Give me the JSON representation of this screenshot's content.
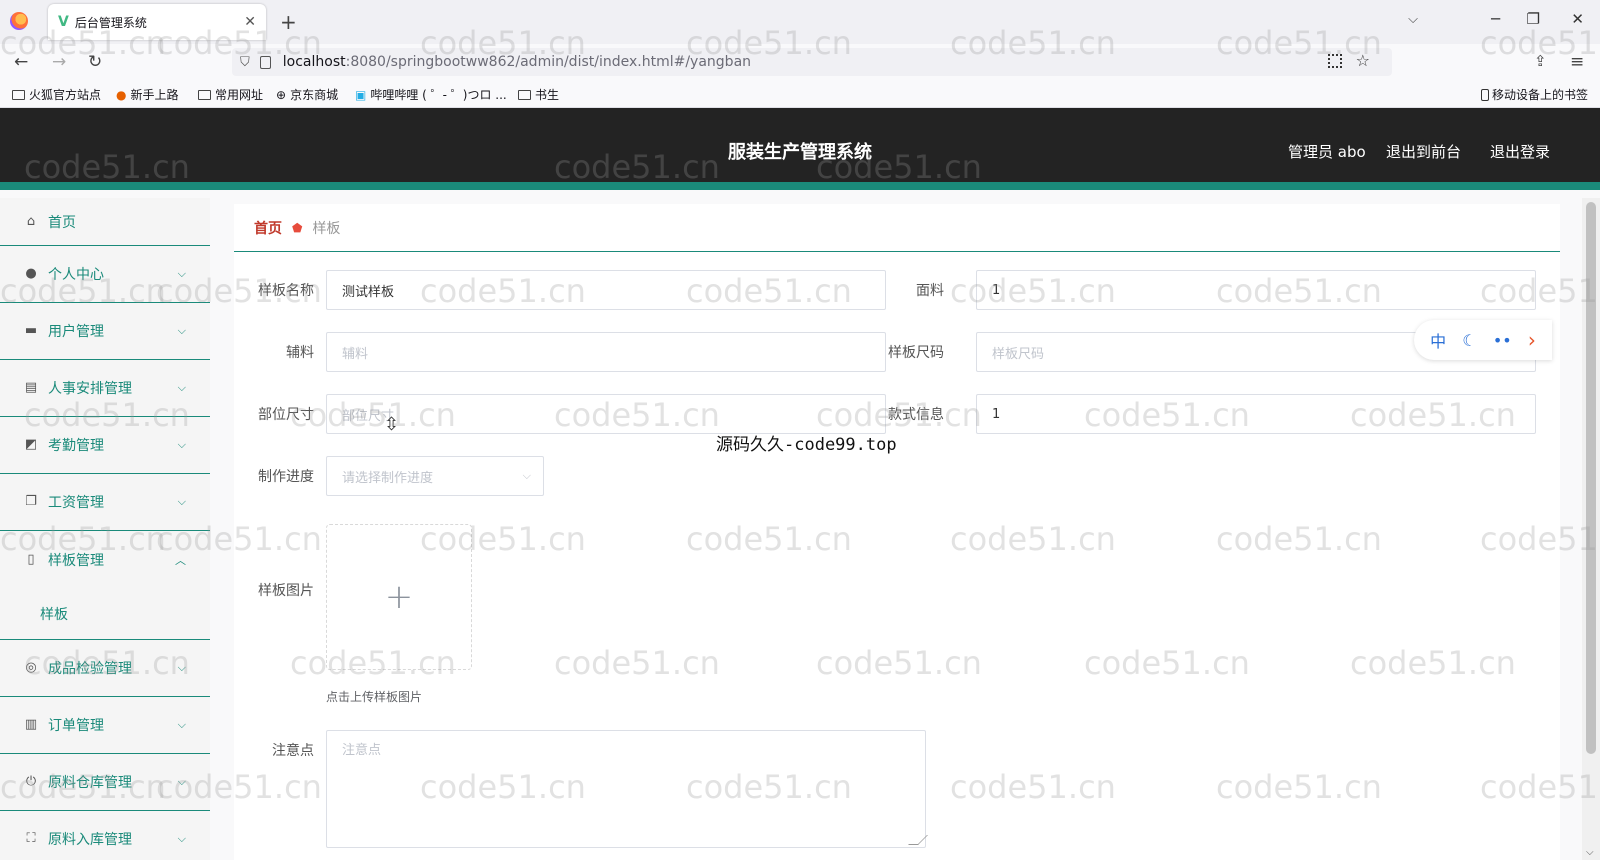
{
  "browser": {
    "tab_title": "后台管理系统",
    "url_host": "localhost",
    "url_path": ":8080/springbootww862/admin/dist/index.html#/yangban",
    "bookmarks": [
      "火狐官方站点",
      "新手上路",
      "常用网址",
      "京东商城",
      "哔哩哔哩 ( ゜- ゜)つロ ...",
      "书生"
    ],
    "mobile_bookmarks": "移动设备上的书签"
  },
  "header": {
    "title": "服装生产管理系统",
    "user": "管理员 abo",
    "front": "退出到前台",
    "logout": "退出登录"
  },
  "sidebar": {
    "items": [
      {
        "label": "首页",
        "icon": "home-icon"
      },
      {
        "label": "个人中心",
        "icon": "user-icon"
      },
      {
        "label": "用户管理",
        "icon": "briefcase-icon"
      },
      {
        "label": "人事安排管理",
        "icon": "clipboard-icon"
      },
      {
        "label": "考勤管理",
        "icon": "chart-icon"
      },
      {
        "label": "工资管理",
        "icon": "copy-icon"
      },
      {
        "label": "样板管理",
        "icon": "phone-icon"
      },
      {
        "label": "成品检验管理",
        "icon": "compass-icon"
      },
      {
        "label": "订单管理",
        "icon": "barchart-icon"
      },
      {
        "label": "原料仓库管理",
        "icon": "power-icon"
      },
      {
        "label": "原料入库管理",
        "icon": "fullscreen-icon"
      }
    ],
    "sub_item": "样板"
  },
  "breadcrumb": {
    "home": "首页",
    "current": "样板"
  },
  "form": {
    "name_label": "样板名称",
    "name_value": "测试样板",
    "fabric_label": "面料",
    "fabric_value": "1",
    "accessory_label": "辅料",
    "accessory_placeholder": "辅料",
    "size_label": "样板尺码",
    "size_placeholder": "样板尺码",
    "part_label": "部位尺寸",
    "part_value": "部位尺寸",
    "style_label": "款式信息",
    "style_value": "1",
    "progress_label": "制作进度",
    "progress_placeholder": "请选择制作进度",
    "image_label": "样板图片",
    "image_tip": "点击上传样板图片",
    "notes_label": "注意点",
    "notes_placeholder": "注意点"
  },
  "tools": {
    "lang": "中"
  },
  "overlay": "源码久久-code99.top",
  "watermark": "code51.cn",
  "colors": {
    "accent": "#1a8a7a",
    "header_bg": "#232323",
    "breadcrumb_home": "#c0392b"
  }
}
